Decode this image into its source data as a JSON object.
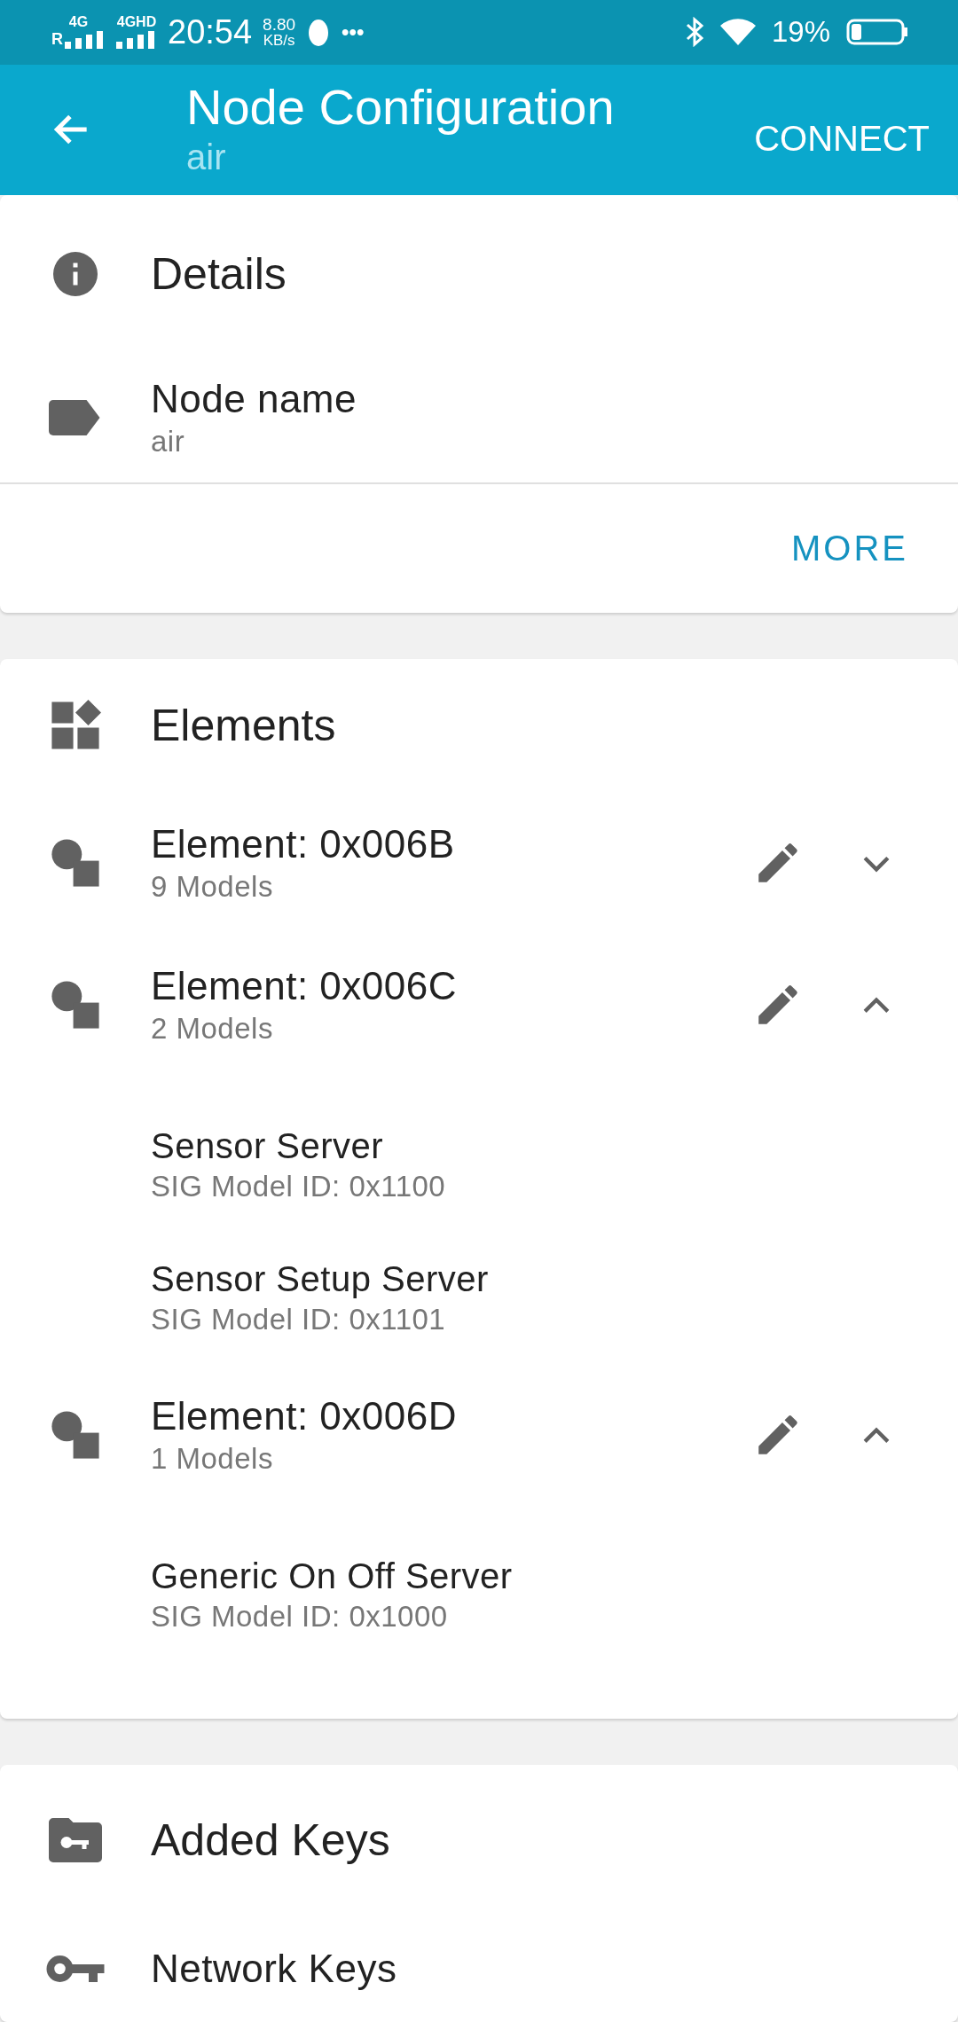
{
  "status_bar": {
    "network_1": "4G",
    "roaming": "R",
    "network_2": "4GHD",
    "time": "20:54",
    "speed_value": "8.80",
    "speed_unit": "KB/s",
    "more": "•••",
    "battery": "19%"
  },
  "app_bar": {
    "title": "Node Configuration",
    "subtitle": "air",
    "action": "CONNECT"
  },
  "details": {
    "title": "Details",
    "items": [
      {
        "label": "Node name",
        "value": "air"
      }
    ],
    "action": "MORE"
  },
  "elements": {
    "title": "Elements",
    "items": [
      {
        "name": "Element: 0x006B",
        "count": "9 Models",
        "expanded": false
      },
      {
        "name": "Element: 0x006C",
        "count": "2 Models",
        "expanded": true,
        "models": [
          {
            "name": "Sensor Server",
            "id": "SIG Model ID: 0x1100"
          },
          {
            "name": "Sensor Setup Server",
            "id": "SIG Model ID: 0x1101"
          }
        ]
      },
      {
        "name": "Element: 0x006D",
        "count": "1 Models",
        "expanded": true,
        "models": [
          {
            "name": "Generic On Off Server",
            "id": "SIG Model ID: 0x1000"
          }
        ]
      }
    ]
  },
  "keys": {
    "title": "Added Keys",
    "items": [
      {
        "label": "Network Keys"
      }
    ]
  }
}
